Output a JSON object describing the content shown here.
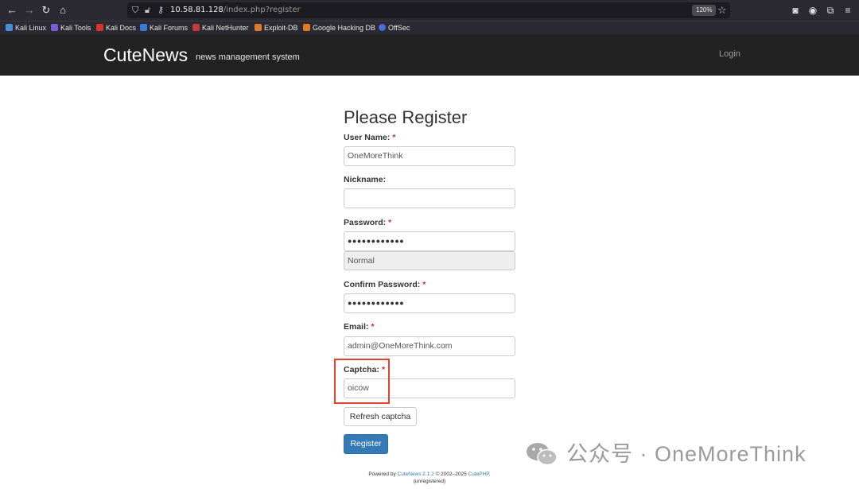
{
  "browser": {
    "url_host": "10.58.81.128",
    "url_path": "/index.php?register",
    "zoom": "120%",
    "bookmarks": [
      "Kali Linux",
      "Kali Tools",
      "Kali Docs",
      "Kali Forums",
      "Kali NetHunter",
      "Exploit-DB",
      "Google Hacking DB",
      "OffSec"
    ]
  },
  "site": {
    "brand": "CuteNews",
    "tagline": "news management system",
    "login_label": "Login"
  },
  "form": {
    "title": "Please Register",
    "username_label": "User Name:",
    "username_value": "OneMoreThink",
    "nickname_label": "Nickname:",
    "nickname_value": "",
    "password_label": "Password:",
    "password_value": "●●●●●●●●●●●●",
    "strength_value": "Normal",
    "confirm_label": "Confirm Password:",
    "confirm_value": "●●●●●●●●●●●●",
    "email_label": "Email:",
    "email_value": "admin@OneMoreThink.com",
    "captcha_label": "Captcha:",
    "captcha_value": "oicow",
    "required_mark": "*",
    "refresh_label": "Refresh captcha",
    "register_label": "Register"
  },
  "footer": {
    "powered_by": "Powered by",
    "product": "CuteNews 2.1.2",
    "copyright": "© 2002–2025",
    "vendor": "CutePHP",
    "period": ".",
    "status": "(unregistered)"
  },
  "watermark": {
    "text": "公众号 · OneMoreThink"
  },
  "colors": {
    "navbar": "#222222",
    "primary": "#337ab7",
    "highlight": "#e2422b",
    "required": "#c9302c"
  }
}
